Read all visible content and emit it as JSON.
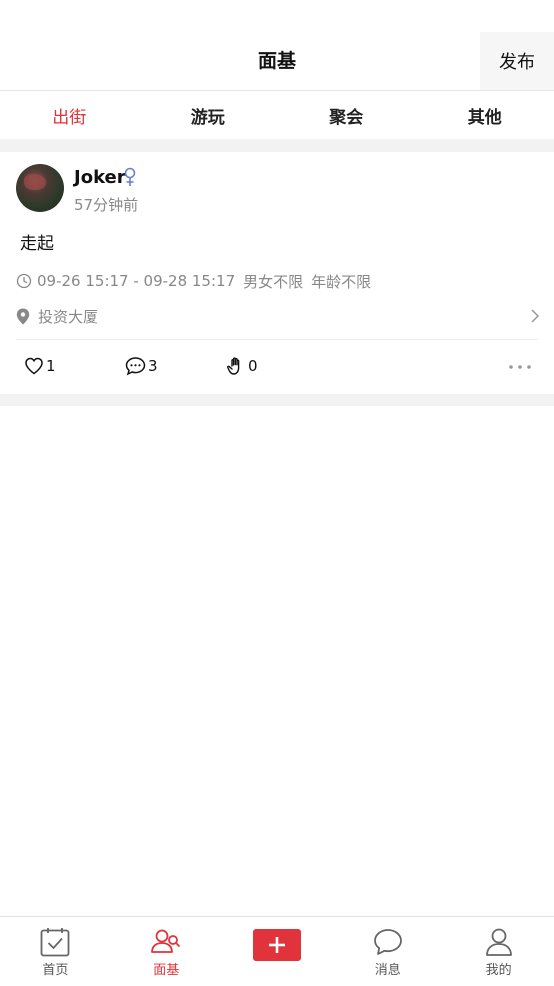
{
  "header": {
    "title": "面基",
    "publish_label": "发布"
  },
  "tabs": [
    {
      "label": "出街",
      "active": true
    },
    {
      "label": "游玩",
      "active": false
    },
    {
      "label": "聚会",
      "active": false
    },
    {
      "label": "其他",
      "active": false
    }
  ],
  "post": {
    "username": "Joker",
    "gender_icon": "female-icon",
    "time_ago": "57分钟前",
    "content": "走起",
    "time_range": "09-26 15:17 - 09-28 15:17",
    "gender_limit": "男女不限",
    "age_limit": "年龄不限",
    "location": "投资大厦",
    "likes": "1",
    "comments": "3",
    "raises": "0"
  },
  "bottom_nav": [
    {
      "label": "首页",
      "icon": "calendar-check-icon",
      "active": false
    },
    {
      "label": "面基",
      "icon": "users-icon",
      "active": true
    },
    {
      "label": "",
      "icon": "plus-icon",
      "active": false
    },
    {
      "label": "消息",
      "icon": "chat-bubble-icon",
      "active": false
    },
    {
      "label": "我的",
      "icon": "user-icon",
      "active": false
    }
  ],
  "colors": {
    "accent": "#e0333b",
    "gender_icon": "#6a7fd6",
    "muted_text": "#888888"
  }
}
